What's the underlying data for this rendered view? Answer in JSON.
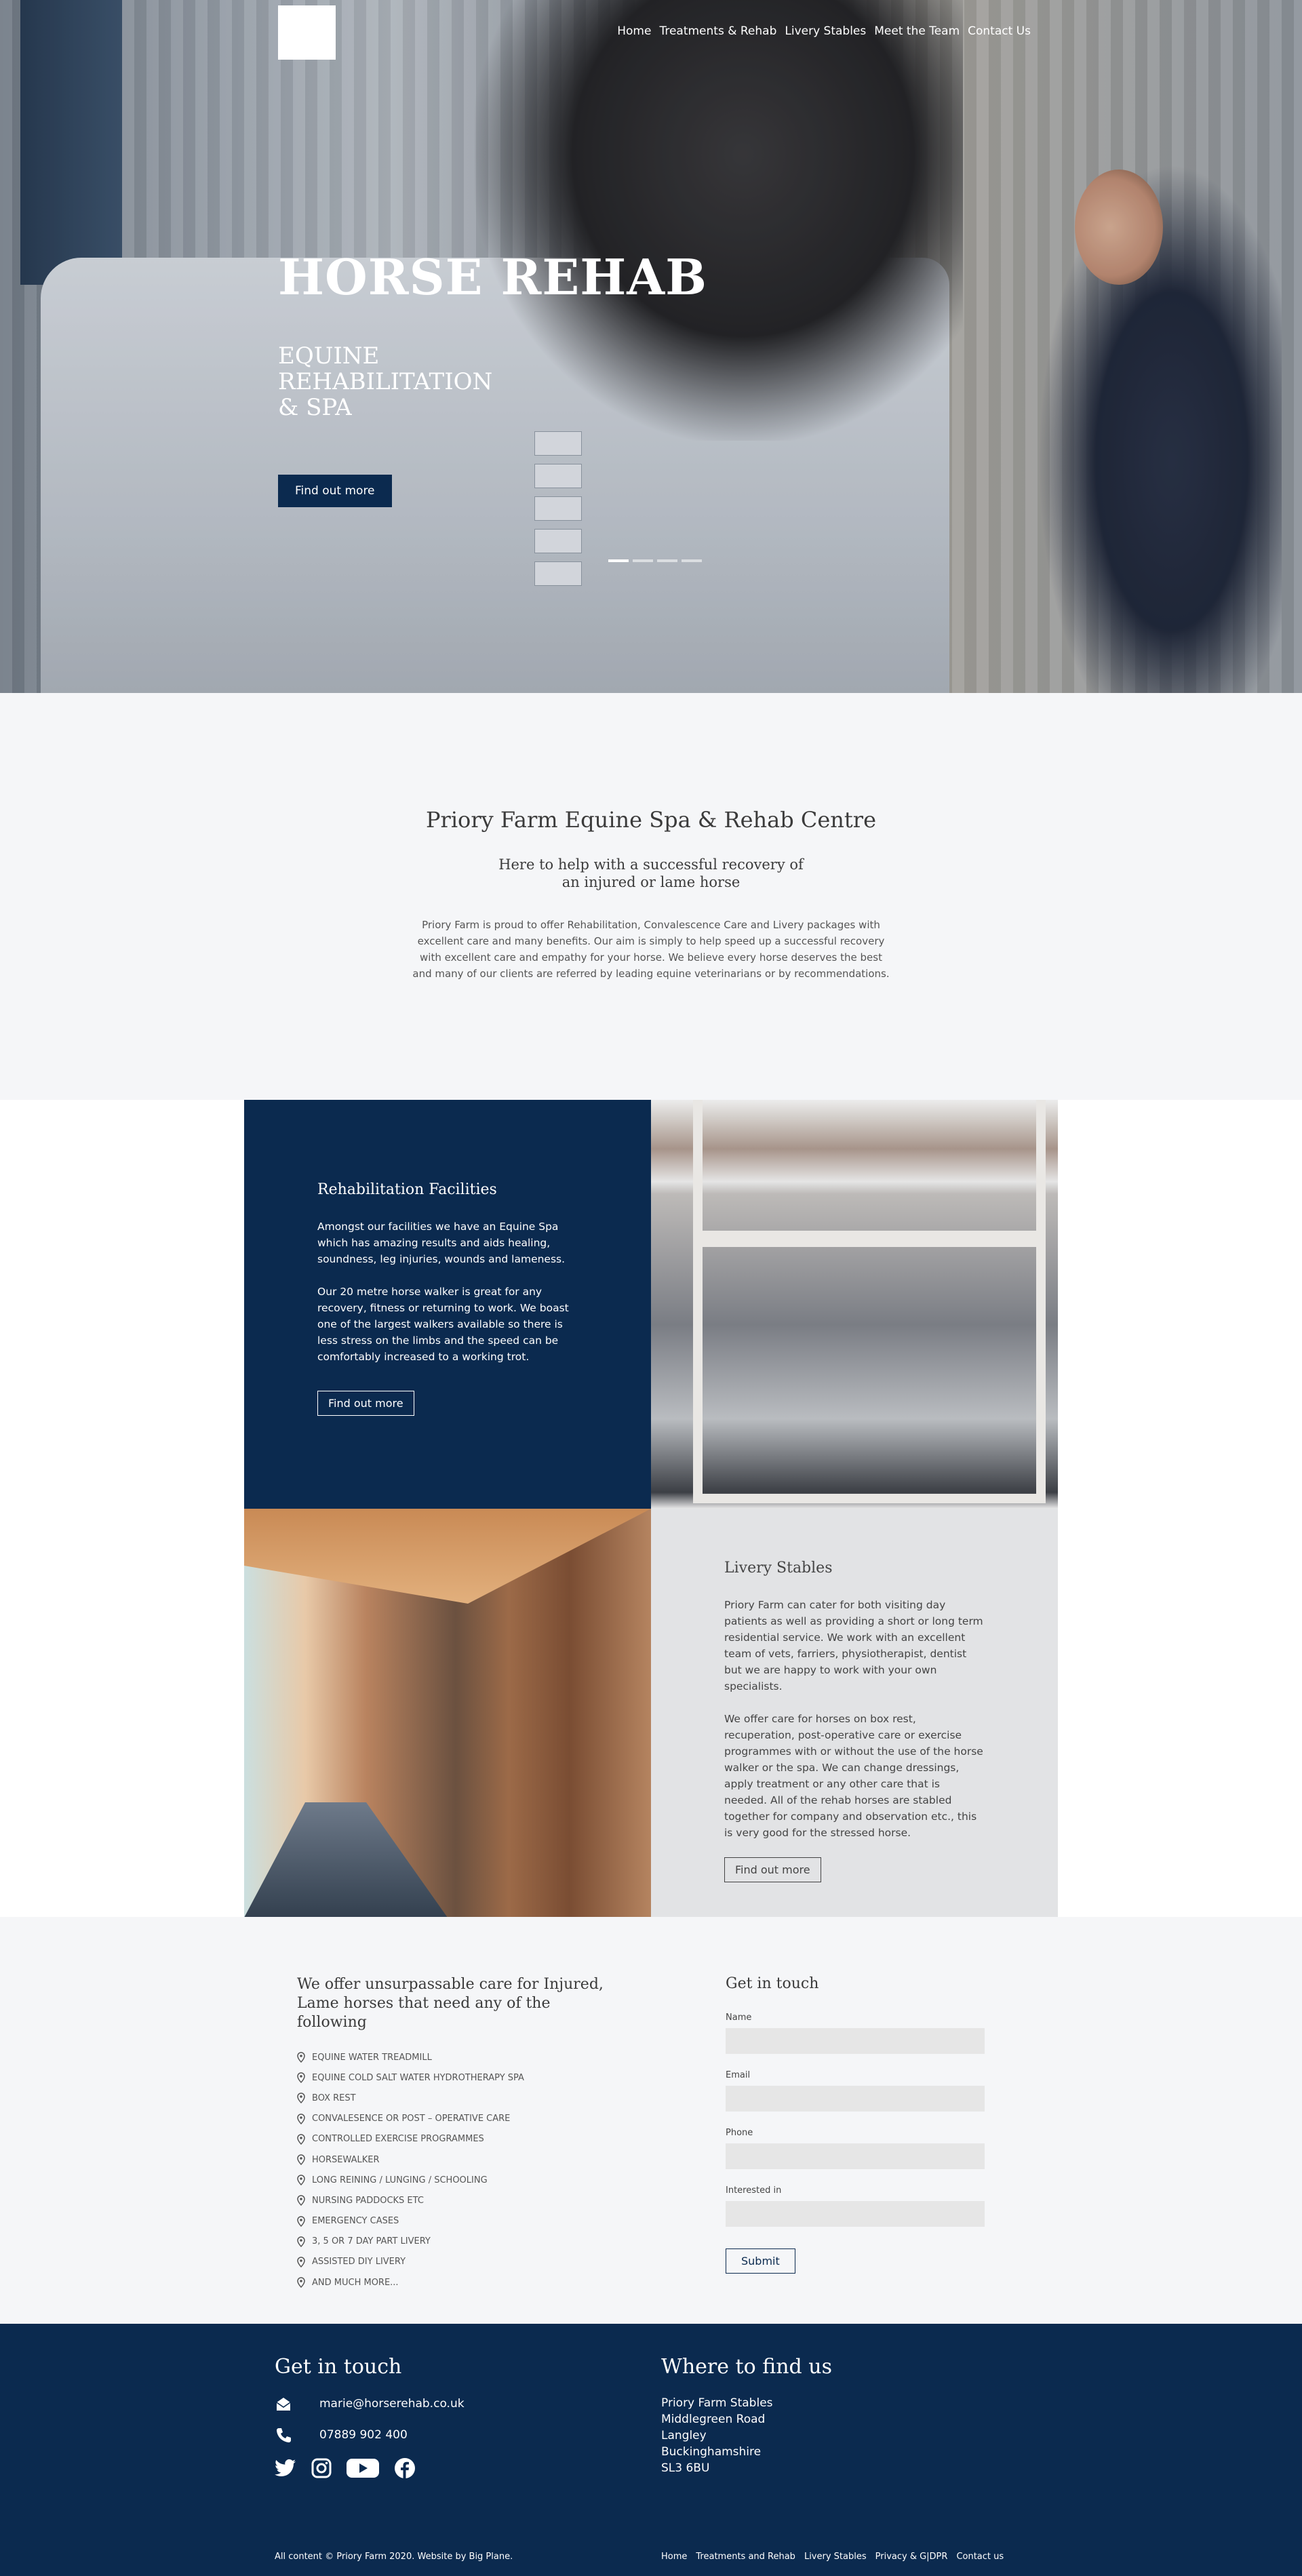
{
  "nav": {
    "items": [
      "Home",
      "Treatments & Rehab",
      "Livery Stables",
      "Meet the Team",
      "Contact Us"
    ]
  },
  "hero": {
    "title": "HORSE REHAB",
    "subtitle": "Equine Rehabilitation & Spa",
    "cta": "Find out more",
    "slides": 4,
    "active_slide": 1
  },
  "intro": {
    "heading": "Priory Farm Equine Spa & Rehab Centre",
    "subheading": "Here to help with a successful recovery of an injured or lame horse",
    "body": "Priory Farm is proud to offer Rehabilitation, Convalescence Care and Livery packages with excellent care and many benefits. Our aim is simply to help speed up a successful recovery with excellent care and empathy for your horse. We believe every horse deserves the best and many of our clients are referred by leading equine veterinarians or by recommendations."
  },
  "rehab": {
    "title": "Rehabilitation Facilities",
    "p1": "Amongst our facilities we have an Equine Spa which has amazing results and aids healing, soundness, leg injuries, wounds and lameness.",
    "p2": "Our 20 metre horse walker is great for any recovery, fitness or returning to work. We boast one of the largest walkers available so there is less stress on the limbs and the speed can be comfortably increased to a working trot.",
    "cta": "Find out more"
  },
  "livery": {
    "title": "Livery Stables",
    "p1": "Priory Farm can cater for both visiting day patients as well as providing a short or long term residential service. We work with an excellent team of vets, farriers, physiotherapist, dentist but we are happy to work with your own specialists.",
    "p2": "We offer care for horses on box rest, recuperation, post-operative care or exercise programmes with or without the use of the horse walker or the spa. We can change dressings, apply treatment or any other care that is needed. All of the rehab horses are stabled together for company and observation etc., this is very good for the stressed horse.",
    "cta": "Find out more"
  },
  "services": {
    "heading": "We offer unsurpassable care for Injured, Lame horses that need any of the following",
    "items": [
      "Equine Water Treadmill",
      "Equine Cold Salt Water Hydrotherapy Spa",
      "Box Rest",
      "Convalesence  or  Post – Operative Care",
      "Controlled Exercise Programmes",
      "Horsewalker",
      "Long Reining / Lunging / Schooling",
      "Nursing Paddocks etc",
      "Emergency Cases",
      "3, 5 or 7 Day Part Livery",
      "Assisted DIY Livery",
      "And much more..."
    ]
  },
  "form": {
    "title": "Get in touch",
    "labels": {
      "name": "Name",
      "email": "Email",
      "phone": "Phone",
      "interest": "Interested in"
    },
    "submit": "Submit"
  },
  "footer": {
    "contact_title": "Get in touch",
    "email": "marie@horserehab.co.uk",
    "phone": "07889 902 400",
    "find_title": "Where to find us",
    "address": [
      "Priory Farm Stables",
      "Middlegreen Road",
      "Langley",
      "Buckinghamshire",
      "SL3 6BU"
    ],
    "copyright": "All content © Priory Farm 2020.  Website by Big Plane.",
    "links": [
      "Home",
      "Treatments and Rehab",
      "Livery Stables",
      "Privacy & G|DPR",
      "Contact us"
    ]
  },
  "colors": {
    "navy": "#0b2a4f",
    "light_bg": "#f5f6f8",
    "grey_tile": "#e2e3e5"
  }
}
